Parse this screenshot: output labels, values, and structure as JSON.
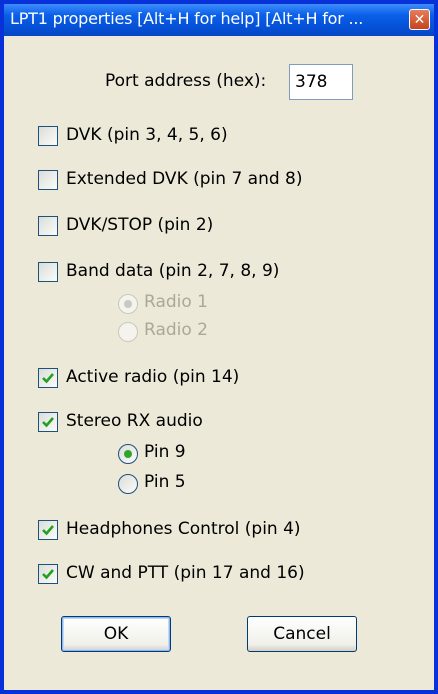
{
  "window": {
    "title": "LPT1 properties [Alt+H for help] [Alt+H for ..."
  },
  "port": {
    "label": "Port address (hex):",
    "value": "378"
  },
  "options": {
    "dvk": {
      "label": "DVK (pin 3, 4, 5, 6)",
      "checked": false
    },
    "extended_dvk": {
      "label": "Extended DVK (pin 7 and 8)",
      "checked": false
    },
    "dvk_stop": {
      "label": "DVK/STOP (pin 2)",
      "checked": false
    },
    "band_data": {
      "label": "Band data (pin 2, 7, 8, 9)",
      "checked": false
    },
    "active_radio": {
      "label": "Active radio (pin 14)",
      "checked": true
    },
    "stereo_rx": {
      "label": "Stereo RX audio",
      "checked": true
    },
    "headphones": {
      "label": "Headphones Control (pin 4)",
      "checked": true
    },
    "cw_ptt": {
      "label": "CW and PTT (pin 17 and 16)",
      "checked": true
    }
  },
  "band_radios": {
    "radio1": {
      "label": "Radio 1",
      "selected": true,
      "disabled": true
    },
    "radio2": {
      "label": "Radio 2",
      "selected": false,
      "disabled": true
    }
  },
  "stereo_radios": {
    "pin9": {
      "label": "Pin 9",
      "selected": true
    },
    "pin5": {
      "label": "Pin 5",
      "selected": false
    }
  },
  "buttons": {
    "ok": "OK",
    "cancel": "Cancel"
  },
  "colors": {
    "titlebar": "#0a5fe8",
    "dialog_bg": "#ece9d8",
    "check_green": "#21a121",
    "close_red": "#c3441e",
    "disabled_text": "#aca899"
  },
  "icons": {
    "close": "close-icon",
    "check": "checkmark-icon"
  }
}
